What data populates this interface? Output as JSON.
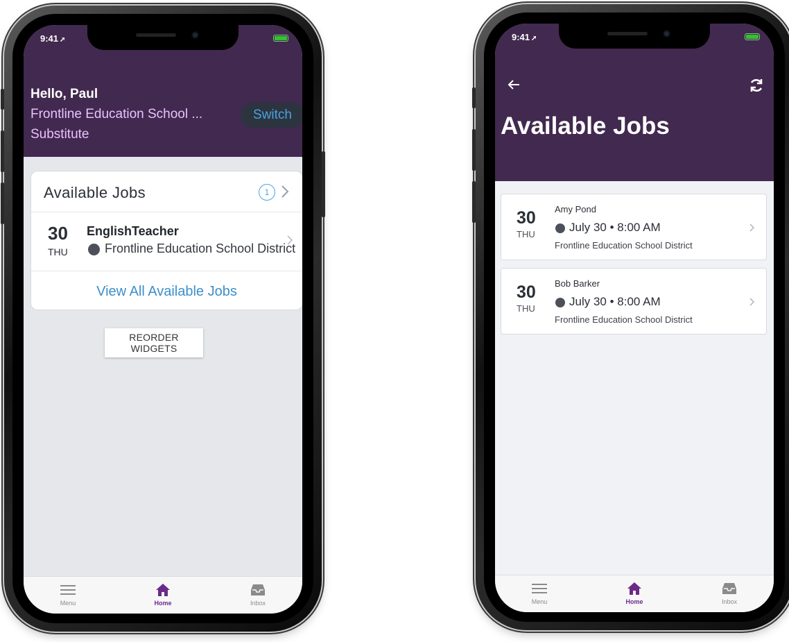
{
  "status": {
    "time": "9:41"
  },
  "left": {
    "greeting": "Hello, Paul",
    "organization": "Frontline Education School ...",
    "role": "Substitute",
    "switch_label": "Switch",
    "widget": {
      "title": "Available Jobs",
      "count": "1",
      "job": {
        "day": "30",
        "dow": "THU",
        "title": "EnglishTeacher",
        "district": "Frontline Education School District"
      },
      "view_all_label": "View All Available Jobs"
    },
    "reorder_label": "REORDER WIDGETS"
  },
  "right": {
    "title": "Available Jobs",
    "jobs": [
      {
        "day": "30",
        "dow": "THU",
        "name": "Amy Pond",
        "when": "July 30 • 8:00 AM",
        "district": "Frontline Education School District"
      },
      {
        "day": "30",
        "dow": "THU",
        "name": "Bob Barker",
        "when": "July 30 • 8:00 AM",
        "district": "Frontline Education School District"
      }
    ]
  },
  "tabbar": {
    "menu": "Menu",
    "home": "Home",
    "inbox": "Inbox"
  },
  "colors": {
    "header": "#42294f",
    "accent": "#4aa3df",
    "active_tab": "#6b2a86"
  },
  "icons": [
    "location-arrow-icon",
    "battery-icon",
    "chevron-right-icon",
    "back-arrow-icon",
    "refresh-icon",
    "menu-icon",
    "home-icon",
    "inbox-icon"
  ]
}
